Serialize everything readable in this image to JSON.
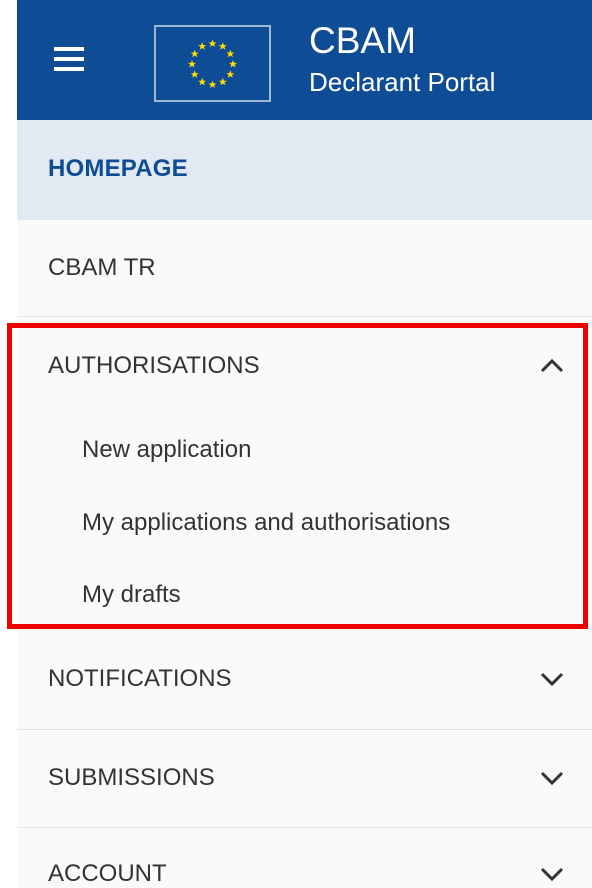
{
  "header": {
    "menu_icon": "hamburger-menu-icon",
    "flag_icon": "eu-flag-icon",
    "title": "CBAM",
    "subtitle": "Declarant Portal",
    "background_color": "#0e4c96"
  },
  "nav": {
    "homepage": {
      "label": "HOMEPAGE",
      "active": true
    },
    "cbam_tr": {
      "label": "CBAM TR"
    },
    "authorisations": {
      "label": "AUTHORISATIONS",
      "expanded": true,
      "chevron_icon": "chevron-up-icon",
      "items": [
        {
          "label": "New application"
        },
        {
          "label": "My applications and authorisations"
        },
        {
          "label": "My drafts"
        }
      ]
    },
    "notifications": {
      "label": "NOTIFICATIONS",
      "chevron_icon": "chevron-down-icon"
    },
    "submissions": {
      "label": "SUBMISSIONS",
      "chevron_icon": "chevron-down-icon"
    },
    "account": {
      "label": "ACCOUNT",
      "chevron_icon": "chevron-down-icon"
    }
  },
  "highlight_color": "#ee0000"
}
